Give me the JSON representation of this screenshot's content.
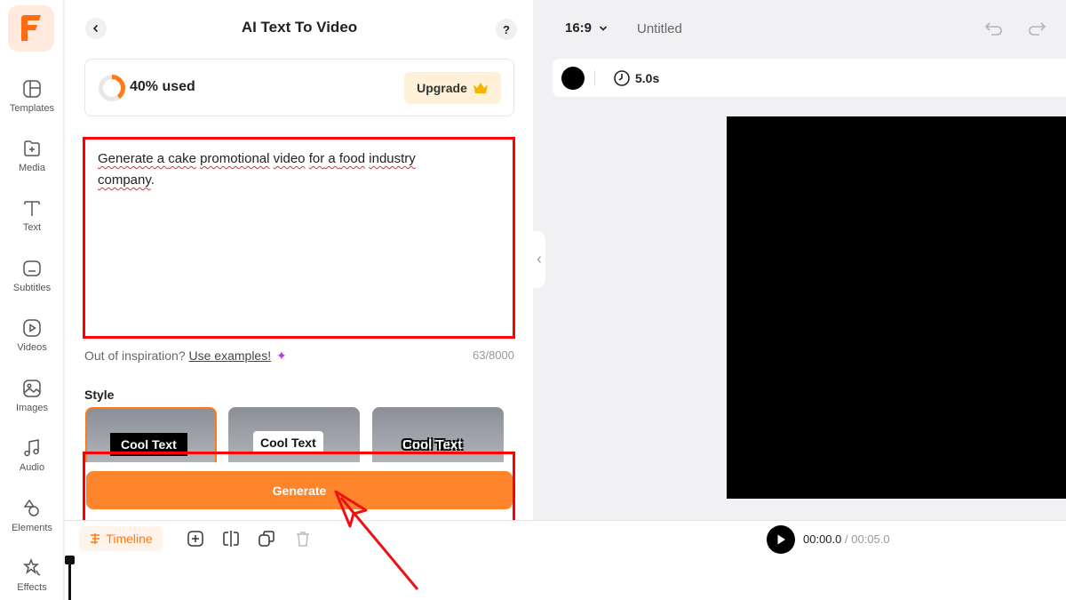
{
  "app": {
    "brand_color": "#ff7a1a",
    "logo_icon": "brand-f-logo"
  },
  "rail": {
    "items": [
      {
        "label": "Templates",
        "icon": "templates-icon"
      },
      {
        "label": "Media",
        "icon": "media-add-icon"
      },
      {
        "label": "Text",
        "icon": "text-icon"
      },
      {
        "label": "Subtitles",
        "icon": "subtitles-icon"
      },
      {
        "label": "Videos",
        "icon": "videos-icon"
      },
      {
        "label": "Images",
        "icon": "images-icon"
      },
      {
        "label": "Audio",
        "icon": "audio-icon"
      },
      {
        "label": "Elements",
        "icon": "elements-icon"
      },
      {
        "label": "Effects",
        "icon": "effects-icon"
      }
    ]
  },
  "panel": {
    "title": "AI Text To Video",
    "help_label": "?",
    "usage": {
      "text": "40% used",
      "percent": 40
    },
    "upgrade_label": "Upgrade",
    "prompt": {
      "words": [
        "Generate",
        " a ",
        "cake",
        " ",
        "promotional",
        " ",
        "video",
        " ",
        "for",
        " a ",
        "food",
        " ",
        "industry",
        " ",
        "company",
        "."
      ]
    },
    "inspire_text": "Out of inspiration?",
    "inspire_link": "Use examples!",
    "char_count": "63/8000",
    "style_label": "Style",
    "styles": [
      {
        "label": "Cool Text",
        "selected": true
      },
      {
        "label": "Cool Text",
        "selected": false
      },
      {
        "label": "Cool Text",
        "selected": false
      }
    ],
    "generate_label": "Generate"
  },
  "topbar": {
    "aspect_ratio": "16:9",
    "doc_title": "Untitled"
  },
  "canvas_toolbar": {
    "background_color": "#000000",
    "duration": "5.0s"
  },
  "timeline": {
    "label": "Timeline",
    "current_time": "00:00.0",
    "separator": " / ",
    "total_time": "00:05.0"
  }
}
